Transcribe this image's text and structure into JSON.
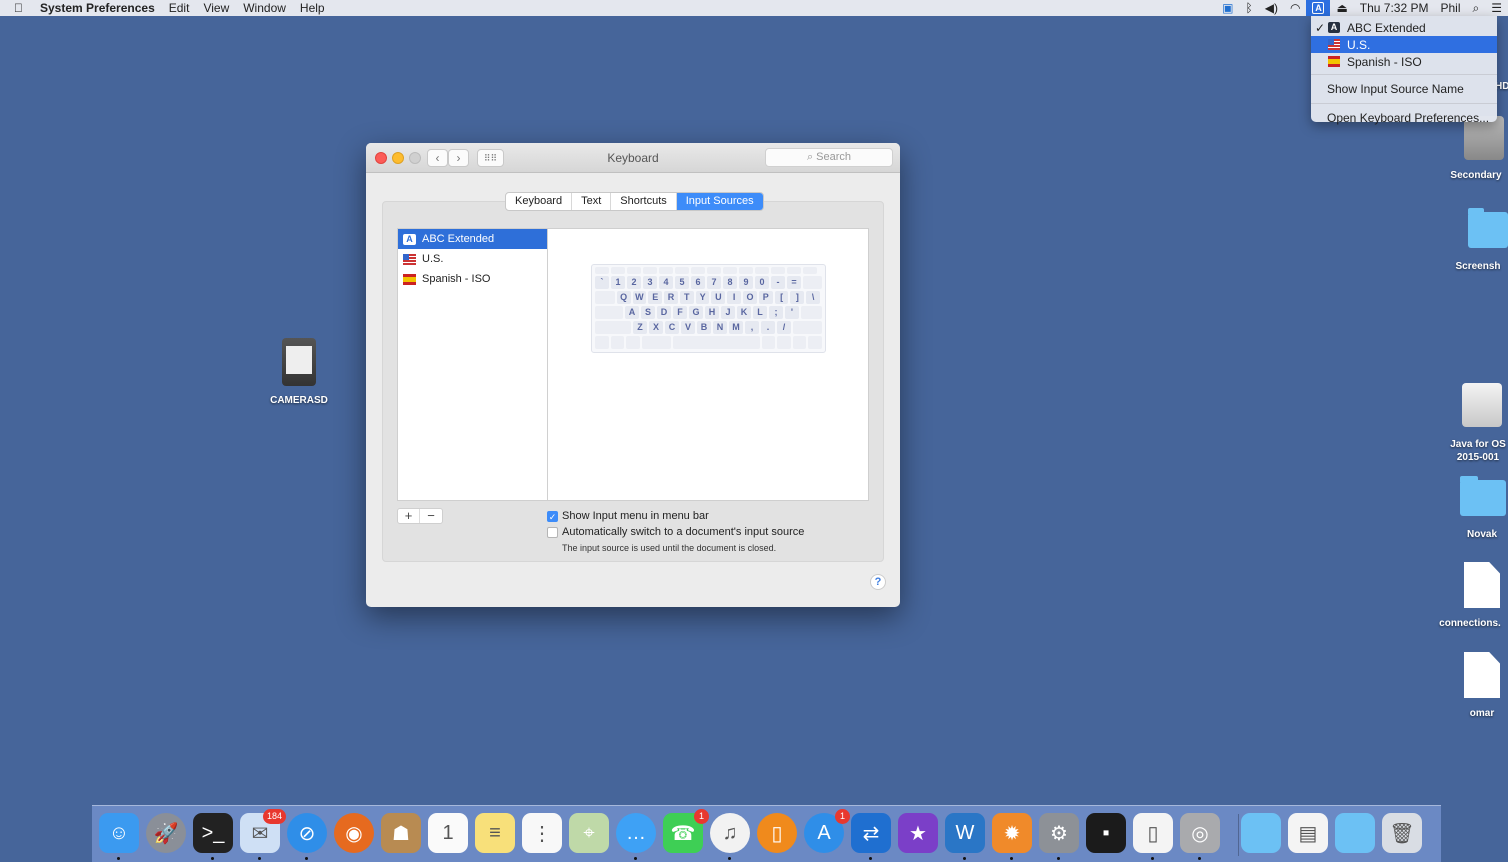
{
  "menubar": {
    "app": "System Preferences",
    "items": [
      "Edit",
      "View",
      "Window",
      "Help"
    ],
    "clock": "Thu 7:32 PM",
    "user": "Phil"
  },
  "input_menu": {
    "sources": [
      {
        "label": "ABC Extended",
        "checked": true,
        "icon": "abc-icon"
      },
      {
        "label": "U.S.",
        "highlighted": true,
        "icon": "us-flag-icon"
      },
      {
        "label": "Spanish - ISO",
        "icon": "spanish-flag-icon"
      }
    ],
    "show_name": "Show Input Source Name",
    "open_prefs": "Open Keyboard Preferences..."
  },
  "window": {
    "title": "Keyboard",
    "search_placeholder": "Search",
    "tabs": [
      "Keyboard",
      "Text",
      "Shortcuts",
      "Input Sources"
    ],
    "active_tab": "Input Sources",
    "sources": [
      {
        "label": "ABC Extended",
        "selected": true
      },
      {
        "label": "U.S."
      },
      {
        "label": "Spanish - ISO"
      }
    ],
    "keyboard_rows": [
      [
        "`",
        "1",
        "2",
        "3",
        "4",
        "5",
        "6",
        "7",
        "8",
        "9",
        "0",
        "-",
        "="
      ],
      [
        "Q",
        "W",
        "E",
        "R",
        "T",
        "Y",
        "U",
        "I",
        "O",
        "P",
        "[",
        "]",
        "\\"
      ],
      [
        "A",
        "S",
        "D",
        "F",
        "G",
        "H",
        "J",
        "K",
        "L",
        ";",
        "'"
      ],
      [
        "Z",
        "X",
        "C",
        "V",
        "B",
        "N",
        "M",
        ",",
        ".",
        "/"
      ]
    ],
    "add_label": "+",
    "remove_label": "−",
    "show_input_menu": {
      "label": "Show Input menu in menu bar",
      "checked": true
    },
    "auto_switch": {
      "label": "Automatically switch to a document's input source",
      "checked": false
    },
    "note": "The input source is used until the document is closed.",
    "help": "?"
  },
  "desktop": {
    "left": [
      {
        "label": "CAMERASD"
      }
    ],
    "right": [
      {
        "label": "HD"
      },
      {
        "label": "Secondary"
      },
      {
        "label": "Screensh"
      },
      {
        "label": "Java for OS 2015-001"
      },
      {
        "label": "Novak"
      },
      {
        "label": "connections."
      },
      {
        "label": "omar"
      }
    ]
  },
  "dock": [
    {
      "icon": "finder-icon",
      "color": "#3b9af0",
      "running": true
    },
    {
      "icon": "launchpad-icon",
      "color": "#8a8f98"
    },
    {
      "icon": "terminal-icon",
      "color": "#222",
      "running": true
    },
    {
      "icon": "mail-stamp-icon",
      "color": "#cfe0f5",
      "badge": "184",
      "running": true
    },
    {
      "icon": "safari-icon",
      "color": "#2f8ee8",
      "running": true
    },
    {
      "icon": "firefox-icon",
      "color": "#e66a1f"
    },
    {
      "icon": "contacts-icon",
      "color": "#b88b52"
    },
    {
      "icon": "calendar-icon",
      "color": "#fafafa"
    },
    {
      "icon": "notes-icon",
      "color": "#f8e07a"
    },
    {
      "icon": "reminders-icon",
      "color": "#f8f8f8"
    },
    {
      "icon": "maps-icon",
      "color": "#bfd9a8"
    },
    {
      "icon": "messages-icon",
      "color": "#3ea1f5",
      "running": true
    },
    {
      "icon": "facetime-icon",
      "color": "#3ecf55",
      "badge": "1"
    },
    {
      "icon": "itunes-icon",
      "color": "#f2f2f2",
      "running": true
    },
    {
      "icon": "ibooks-icon",
      "color": "#f08a1c"
    },
    {
      "icon": "app-store-icon",
      "color": "#2f8ee8",
      "badge": "1"
    },
    {
      "icon": "teamviewer-icon",
      "color": "#1f6fd0",
      "running": true
    },
    {
      "icon": "imovie-icon",
      "color": "#7b3fc8"
    },
    {
      "icon": "wunderlist-icon",
      "color": "#2a76c6",
      "running": true
    },
    {
      "icon": "gear-orange-icon",
      "color": "#f08a2a",
      "running": true
    },
    {
      "icon": "system-preferences-icon",
      "color": "#8d9197",
      "running": true
    },
    {
      "icon": "exec-terminal-icon",
      "color": "#1b1b1b"
    },
    {
      "icon": "libreoffice-icon",
      "color": "#f4f4f4",
      "running": true
    },
    {
      "icon": "image-capture-icon",
      "color": "#a9aaad",
      "running": true
    },
    {
      "icon": "folder-icon",
      "color": "#6cc1f4"
    },
    {
      "icon": "document-icon",
      "color": "#f4f4f4"
    },
    {
      "icon": "folder-icon",
      "color": "#6cc1f4"
    },
    {
      "icon": "trash-icon",
      "color": "#d9dde4"
    }
  ],
  "colors": {
    "desktop": "#46659a",
    "accent": "#3d8cf9",
    "selection": "#2e6fd9"
  }
}
